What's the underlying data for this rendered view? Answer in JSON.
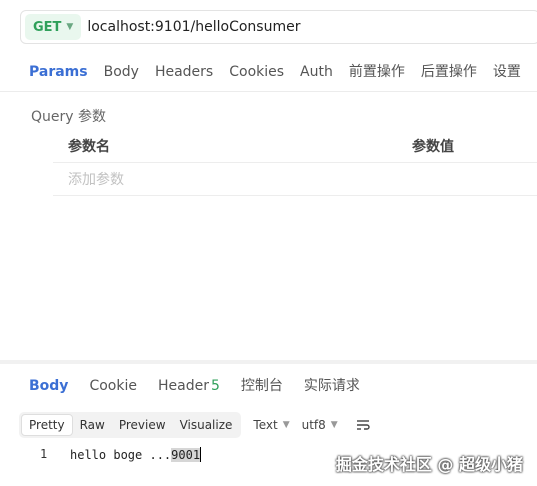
{
  "request": {
    "method": "GET",
    "url": "localhost:9101/helloConsumer",
    "tabs": [
      "Params",
      "Body",
      "Headers",
      "Cookies",
      "Auth",
      "前置操作",
      "后置操作",
      "设置"
    ]
  },
  "params": {
    "section_label": "Query 参数",
    "header_name": "参数名",
    "header_value": "参数值",
    "add_placeholder": "添加参数"
  },
  "response": {
    "tabs": [
      {
        "label": "Body"
      },
      {
        "label": "Cookie"
      },
      {
        "label": "Header",
        "badge": "5"
      },
      {
        "label": "控制台"
      },
      {
        "label": "实际请求"
      }
    ],
    "view_modes": [
      "Pretty",
      "Raw",
      "Preview",
      "Visualize"
    ],
    "format": "Text",
    "encoding": "utf8",
    "line_number": "1",
    "body_plain": "hello boge ...",
    "body_selected": "9001"
  },
  "watermark": "掘金技术社区 @ 超级小猪",
  "colors": {
    "accent": "#3b6fd4",
    "method_green": "#2fa05a"
  }
}
